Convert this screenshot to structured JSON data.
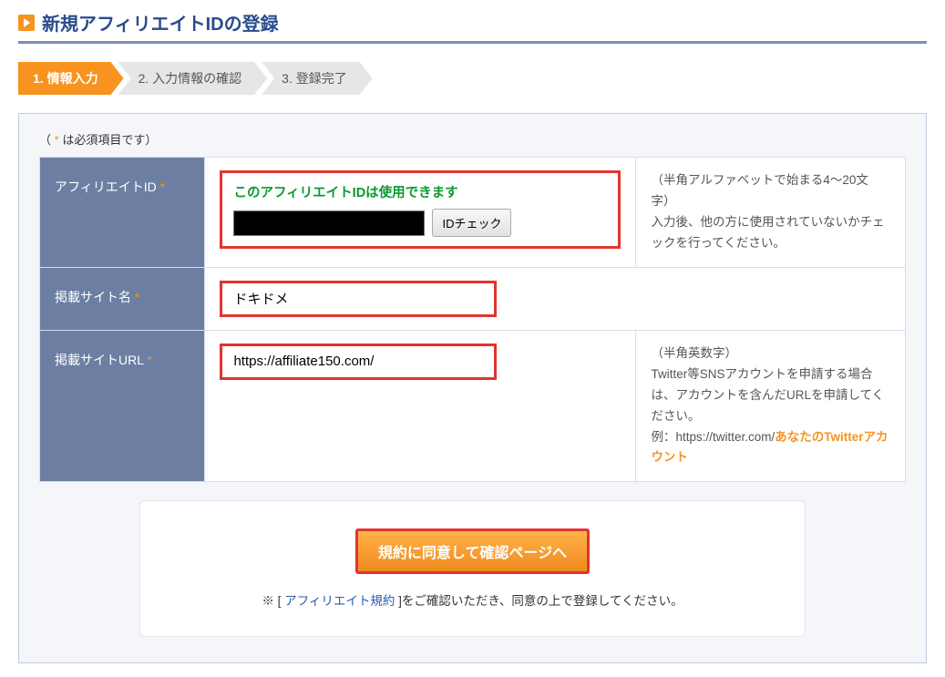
{
  "title": "新規アフィリエイトIDの登録",
  "steps": [
    {
      "label": "1. 情報入力"
    },
    {
      "label": "2. 入力情報の確認"
    },
    {
      "label": "3. 登録完了"
    }
  ],
  "required_note": {
    "left": "（",
    "star": " * ",
    "right": "は必須項目です）"
  },
  "rows": {
    "affiliate_id": {
      "label": "アフィリエイトID",
      "status_msg": "このアフィリエイトIDは使用できます",
      "check_btn": "IDチェック",
      "value": "",
      "hint_line1": "（半角アルファベットで始まる4～20文字）",
      "hint_line2": "入力後、他の方に使用されていないかチェックを行ってください。"
    },
    "site_name": {
      "label": "掲載サイト名",
      "value": "ドキドメ"
    },
    "site_url": {
      "label": "掲載サイトURL",
      "value": "https://affiliate150.com/",
      "hint_line1": "（半角英数字）",
      "hint_line2": "Twitter等SNSアカウントを申請する場合は、アカウントを含んだURLを申請してください。",
      "hint_eg_prefix": "例：https://twitter.com/",
      "hint_eg_strong": "あなたのTwitterアカウント"
    }
  },
  "submit": {
    "btn_label": "規約に同意して確認ページへ",
    "note_prefix": "※ [ ",
    "link_text": "アフィリエイト規約",
    "note_suffix": " ]をご確認いただき、同意の上で登録してください。"
  }
}
